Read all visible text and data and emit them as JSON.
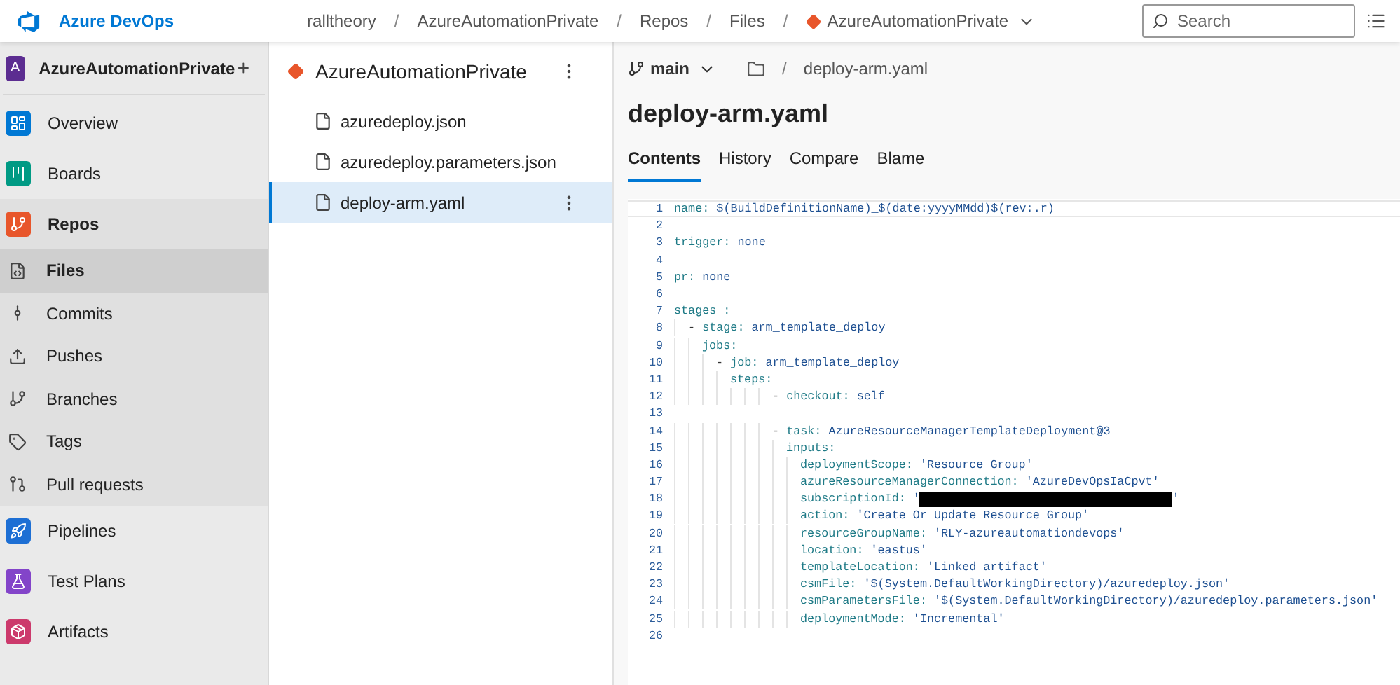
{
  "header": {
    "product": "Azure DevOps",
    "breadcrumbs": [
      {
        "label": "ralltheory",
        "separator": "/"
      },
      {
        "label": "AzureAutomationPrivate",
        "separator": "/"
      },
      {
        "label": "Repos",
        "separator": "/"
      },
      {
        "label": "Files",
        "separator": "/"
      }
    ],
    "repo_picker": "AzureAutomationPrivate",
    "search": {
      "placeholder": "Search"
    }
  },
  "sidebar": {
    "project": {
      "initial": "A",
      "name": "AzureAutomationPrivate"
    },
    "items": [
      {
        "label": "Overview",
        "kind": "overview",
        "selected": false
      },
      {
        "label": "Boards",
        "kind": "boards",
        "selected": false
      },
      {
        "label": "Repos",
        "kind": "repos",
        "selected": false,
        "expanded": true,
        "children": [
          {
            "label": "Files",
            "kind": "files",
            "selected": true
          },
          {
            "label": "Commits",
            "kind": "commits",
            "selected": false
          },
          {
            "label": "Pushes",
            "kind": "pushes",
            "selected": false
          },
          {
            "label": "Branches",
            "kind": "branches",
            "selected": false
          },
          {
            "label": "Tags",
            "kind": "tags",
            "selected": false
          },
          {
            "label": "Pull requests",
            "kind": "pulls",
            "selected": false
          }
        ]
      },
      {
        "label": "Pipelines",
        "kind": "pipelines",
        "selected": false
      },
      {
        "label": "Test Plans",
        "kind": "testplans",
        "selected": false
      },
      {
        "label": "Artifacts",
        "kind": "artifacts",
        "selected": false
      }
    ]
  },
  "file_tree": {
    "repo": "AzureAutomationPrivate",
    "files": [
      {
        "name": "azuredeploy.json",
        "selected": false
      },
      {
        "name": "azuredeploy.parameters.json",
        "selected": false
      },
      {
        "name": "deploy-arm.yaml",
        "selected": true
      }
    ]
  },
  "file_view": {
    "branch": "main",
    "path_separator": "/",
    "path": "deploy-arm.yaml",
    "title": "deploy-arm.yaml",
    "tabs": [
      {
        "label": "Contents",
        "selected": true
      },
      {
        "label": "History",
        "selected": false
      },
      {
        "label": "Compare",
        "selected": false
      },
      {
        "label": "Blame",
        "selected": false
      }
    ],
    "code": [
      {
        "number": "1",
        "text": "name: $(BuildDefinitionName)_$(date:yyyyMMdd)$(rev:.r)",
        "current": true
      },
      {
        "number": "2"
      },
      {
        "number": "3",
        "text": "trigger: none"
      },
      {
        "number": "4"
      },
      {
        "number": "5",
        "text": "pr: none"
      },
      {
        "number": "6"
      },
      {
        "number": "7",
        "text": "stages :"
      },
      {
        "number": "8",
        "text": "  - stage: arm_template_deploy"
      },
      {
        "number": "9",
        "text": "    jobs:"
      },
      {
        "number": "10",
        "text": "      - job: arm_template_deploy"
      },
      {
        "number": "11",
        "text": "        steps:"
      },
      {
        "number": "12",
        "text": "              - checkout: self"
      },
      {
        "number": "13"
      },
      {
        "number": "14",
        "text": "              - task: AzureResourceManagerTemplateDeployment@3"
      },
      {
        "number": "15",
        "text": "                inputs:"
      },
      {
        "number": "16",
        "text": "                  deploymentScope: 'Resource Group'"
      },
      {
        "number": "17",
        "text": "                  azureResourceManagerConnection: 'AzureDevOpsIaCpvt'"
      },
      {
        "number": "18",
        "text": "                  subscriptionId: '",
        "redacted": true,
        "after": "'"
      },
      {
        "number": "19",
        "text": "                  action: 'Create Or Update Resource Group'"
      },
      {
        "number": "20",
        "text": "                  resourceGroupName: 'RLY-azureautomationdevops'"
      },
      {
        "number": "21",
        "text": "                  location: 'eastus'"
      },
      {
        "number": "22",
        "text": "                  templateLocation: 'Linked artifact'"
      },
      {
        "number": "23",
        "text": "                  csmFile: '$(System.DefaultWorkingDirectory)/azuredeploy.json'"
      },
      {
        "number": "24",
        "text": "                  csmParametersFile: '$(System.DefaultWorkingDirectory)/azuredeploy.parameters.json'"
      },
      {
        "number": "25",
        "text": "                  deploymentMode: 'Incremental'"
      },
      {
        "number": "26"
      }
    ]
  }
}
